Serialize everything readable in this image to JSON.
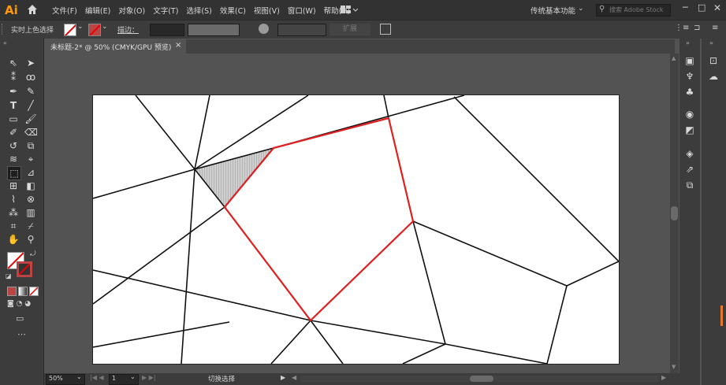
{
  "app": {
    "logo": "Ai",
    "workspace": "传统基本功能",
    "search_placeholder": "搜索 Adobe Stock"
  },
  "menu": [
    "文件(F)",
    "编辑(E)",
    "对象(O)",
    "文字(T)",
    "选择(S)",
    "效果(C)",
    "视图(V)",
    "窗口(W)",
    "帮助(H)"
  ],
  "control": {
    "mode_label": "实时上色选择",
    "stroke_label": "描边：",
    "btn_right": "扩展"
  },
  "document": {
    "tab_title": "未标题-2* @ 50% (CMYK/GPU 预览)",
    "close": "×"
  },
  "status": {
    "zoom": "50%",
    "artboard": "1",
    "tool_name": "切换选择"
  },
  "colors": {
    "selection": "#e02020",
    "menubar": "#323232",
    "panel": "#3c3c3c",
    "canvas": "#535353"
  },
  "icons": {
    "left_tools": [
      "selection-arrow",
      "direct-selection",
      "magic-wand",
      "lasso",
      "pen",
      "curvature",
      "type",
      "line",
      "rectangle",
      "paintbrush",
      "shaper",
      "eraser",
      "rotate",
      "scale",
      "warp",
      "free-transform",
      "live-paint-selection",
      "perspective",
      "mesh",
      "gradient",
      "eyedropper",
      "blend",
      "symbol-sprayer",
      "column-graph",
      "artboard",
      "slice",
      "hand",
      "zoom"
    ],
    "right_panels": [
      "properties",
      "libraries",
      "appearance",
      "color-guide",
      "symbols",
      "swatches",
      "brushes",
      "stroke",
      "layers",
      "transform",
      "pathfinder"
    ]
  }
}
